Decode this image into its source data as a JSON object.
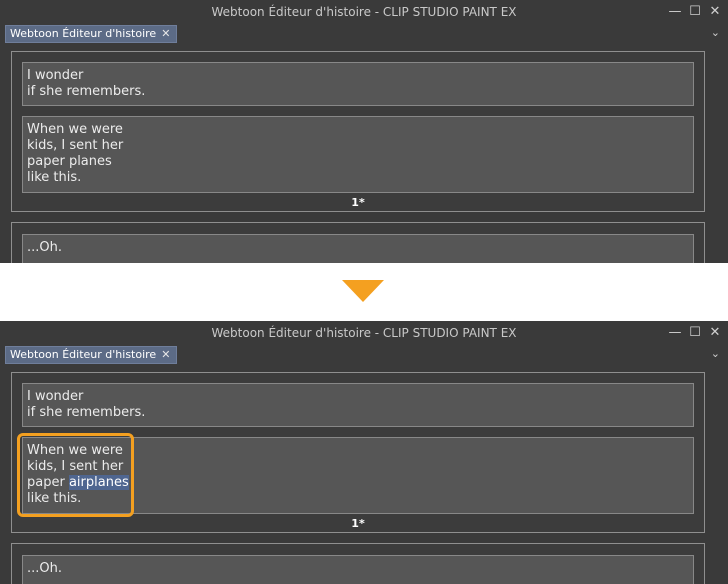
{
  "window": {
    "title": "Webtoon Éditeur d'histoire - CLIP STUDIO PAINT EX",
    "minimize_glyph": "—",
    "maximize_glyph": "☐",
    "close_glyph": "✕"
  },
  "tab": {
    "label": "Webtoon Éditeur d'histoire",
    "close_glyph": "✕",
    "menu_glyph": "⌄"
  },
  "before": {
    "text1": "I wonder\nif she remembers.",
    "text2": "When we were\nkids, I sent her\npaper planes\nlike this.",
    "page_label": "1*",
    "text3": "...Oh."
  },
  "after": {
    "text1": "I wonder\nif she remembers.",
    "text2_pre": "When we were\nkids, I sent her\npaper ",
    "text2_selected": "airplanes",
    "text2_post": "\nlike this.",
    "page_label": "1*",
    "text3": "...Oh."
  },
  "colors": {
    "accent": "#f4a020",
    "selection": "#4f6690"
  }
}
